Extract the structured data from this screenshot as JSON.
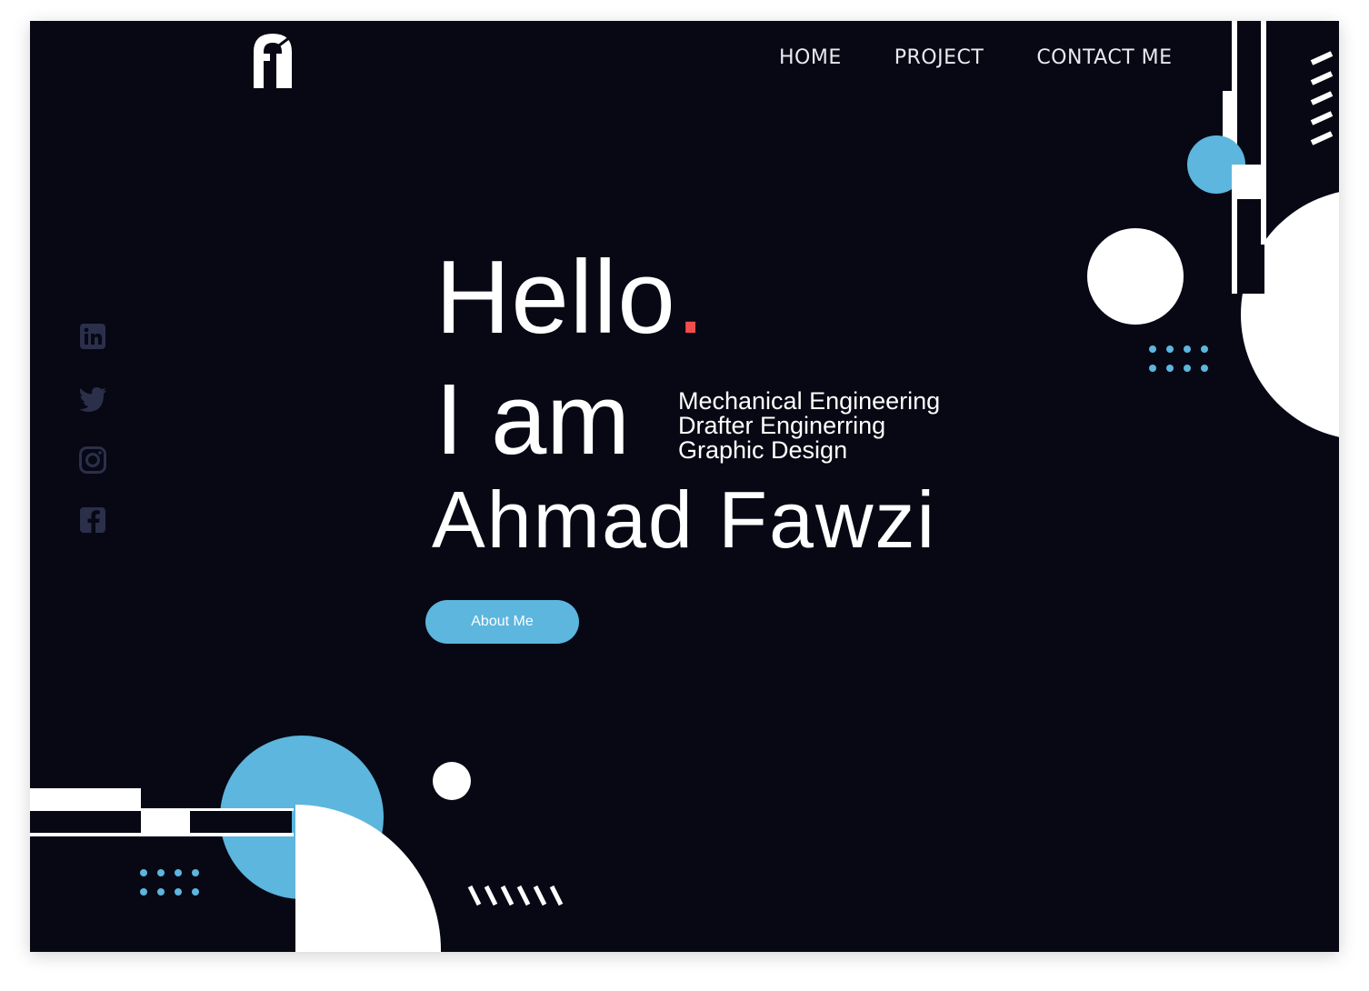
{
  "colors": {
    "background": "#070814",
    "accent_blue": "#5cb6de",
    "accent_red": "#f04e4e",
    "white": "#ffffff",
    "social_icon": "#2b2f4a"
  },
  "header": {
    "logo_icon": "af-monogram-logo",
    "nav": [
      "HOME",
      "PROJECT",
      "CONTACT ME"
    ]
  },
  "social": [
    "linkedin-icon",
    "twitter-icon",
    "instagram-icon",
    "facebook-icon"
  ],
  "hero": {
    "hello": "Hello",
    "hello_dot": ".",
    "i_am": "I am",
    "roles": [
      "Mechanical Engineering",
      "Drafter Enginerring",
      "Graphic Design"
    ],
    "name": "Ahmad Fawzi",
    "cta": "About Me"
  }
}
